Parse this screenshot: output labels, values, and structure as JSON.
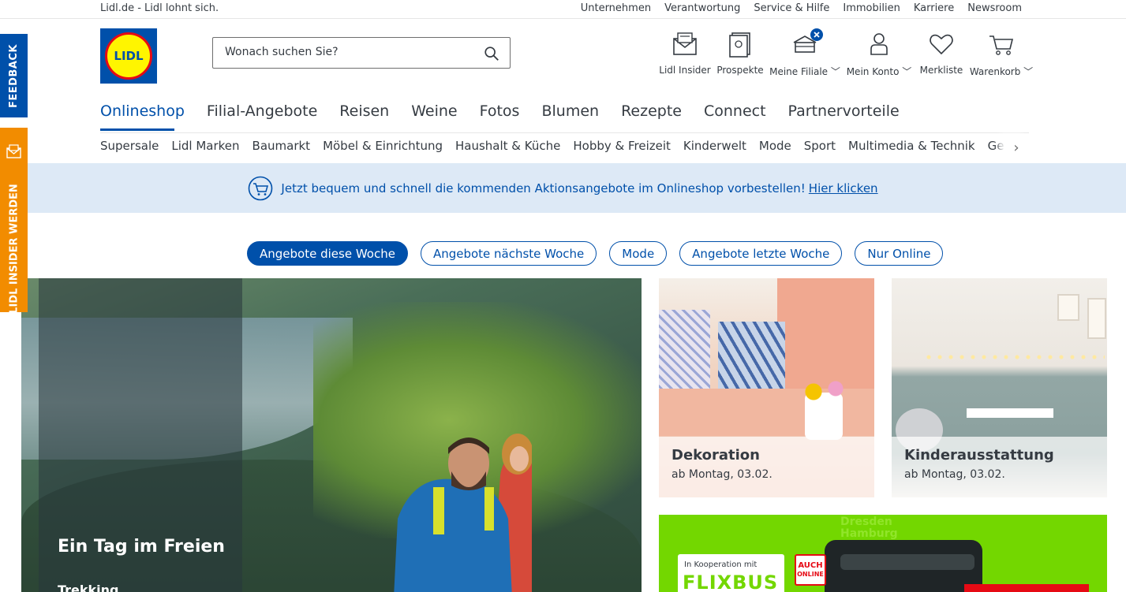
{
  "topbar": {
    "tagline": "Lidl.de - Lidl lohnt sich.",
    "links": [
      "Unternehmen",
      "Verantwortung",
      "Service & Hilfe",
      "Immobilien",
      "Karriere",
      "Newsroom"
    ]
  },
  "logo": {
    "text": "LIDL"
  },
  "search": {
    "placeholder": "Wonach suchen Sie?"
  },
  "actions": [
    {
      "label": "Lidl Insider",
      "icon": "envelope-icon"
    },
    {
      "label": "Prospekte",
      "icon": "brochure-icon"
    },
    {
      "label": "Meine Filiale ﹀",
      "icon": "store-icon"
    },
    {
      "label": "Mein Konto ﹀",
      "icon": "user-icon"
    },
    {
      "label": "Merkliste",
      "icon": "heart-icon"
    },
    {
      "label": "Warenkorb ﹀",
      "icon": "cart-icon"
    }
  ],
  "main_nav": [
    "Onlineshop",
    "Filial-Angebote",
    "Reisen",
    "Weine",
    "Fotos",
    "Blumen",
    "Rezepte",
    "Connect",
    "Partnervorteile"
  ],
  "sub_nav": [
    "Supersale",
    "Lidl Marken",
    "Baumarkt",
    "Möbel & Einrichtung",
    "Haushalt & Küche",
    "Hobby & Freizeit",
    "Kinderwelt",
    "Mode",
    "Sport",
    "Multimedia & Technik",
    "Geschenkgutschein"
  ],
  "banner": {
    "text": "Jetzt bequem und schnell die kommenden Aktionsangebote im Onlineshop vorbestellen!",
    "link": "Hier klicken"
  },
  "pills": [
    "Angebote diese Woche",
    "Angebote nächste Woche",
    "Mode",
    "Angebote letzte Woche",
    "Nur Online"
  ],
  "hero": {
    "title": "Ein Tag im Freien",
    "subtitle": "Trekking"
  },
  "tiles": [
    {
      "title": "Dekoration",
      "subtitle": "ab Montag, 03.02."
    },
    {
      "title": "Kinderausstattung",
      "subtitle": "ab Montag, 03.02."
    }
  ],
  "flixbus": {
    "kooperation": "In Kooperation mit",
    "brand": "FLIXBUS",
    "badge_line1": "AUCH",
    "badge_line2": "ONLINE",
    "cities": "Dresden\nHamburg\nDüsseldorf\nMainz\nAachen  Herne"
  },
  "side_tabs": {
    "feedback": "FEEDBACK",
    "insider": "LIDL INSIDER WERDEN"
  },
  "colors": {
    "brand_blue": "#0050aa",
    "insider_orange": "#f28c00",
    "banner_bg": "#dde9f6",
    "flix_green": "#73d700"
  }
}
